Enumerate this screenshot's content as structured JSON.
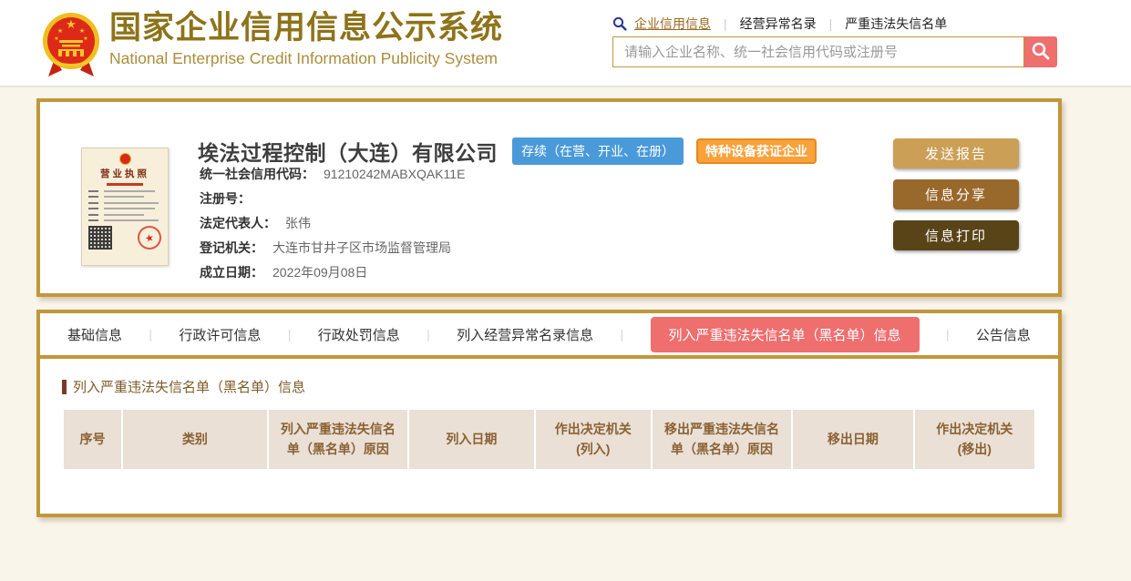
{
  "header": {
    "title": "国家企业信用信息公示系统",
    "subtitle": "National Enterprise Credit Information Publicity System",
    "nav": {
      "item1": "企业信用信息",
      "item2": "经营异常名录",
      "item3": "严重违法失信名单"
    },
    "search": {
      "placeholder": "请输入企业名称、统一社会信用代码或注册号"
    }
  },
  "company": {
    "name": "埃法过程控制（大连）有限公司",
    "status_badge": "存续（在营、开业、在册）",
    "cert_badge": "特种设备获证企业",
    "license_title": "营业执照",
    "fields": [
      {
        "label": "统一社会信用代码：",
        "value": "91210242MABXQAK11E"
      },
      {
        "label": "注册号：",
        "value": ""
      },
      {
        "label": "法定代表人：",
        "value": "张伟"
      },
      {
        "label": "登记机关：",
        "value": "大连市甘井子区市场监督管理局"
      },
      {
        "label": "成立日期：",
        "value": "2022年09月08日"
      }
    ],
    "actions": {
      "send_report": "发送报告",
      "share": "信息分享",
      "print": "信息打印"
    }
  },
  "tabs": [
    {
      "label": "基础信息",
      "active": false
    },
    {
      "label": "行政许可信息",
      "active": false
    },
    {
      "label": "行政处罚信息",
      "active": false
    },
    {
      "label": "列入经营异常名录信息",
      "active": false
    },
    {
      "label": "列入严重违法失信名单（黑名单）信息",
      "active": true
    },
    {
      "label": "公告信息",
      "active": false
    }
  ],
  "blacklist_section": {
    "title": "列入严重违法失信名单（黑名单）信息",
    "table": {
      "headers": [
        "序号",
        "类别",
        "列入严重违法失信名\n单（黑名单）原因",
        "列入日期",
        "作出决定机关\n(列入)",
        "移出严重违法失信名\n单（黑名单）原因",
        "移出日期",
        "作出决定机关\n(移出)"
      ],
      "rows": []
    }
  },
  "colors": {
    "gold_border": "#C2973B",
    "title_gold": "#8E7319",
    "accent_red": "#EF6E6E",
    "badge_blue": "#4A9AD9",
    "badge_orange": "#F9A13A",
    "btn_send": "#CC9F57",
    "btn_share": "#99682B",
    "btn_print": "#594418",
    "table_header_bg": "#EAE0D5",
    "table_header_text": "#8A6134",
    "page_background": "#FAF5EB"
  }
}
